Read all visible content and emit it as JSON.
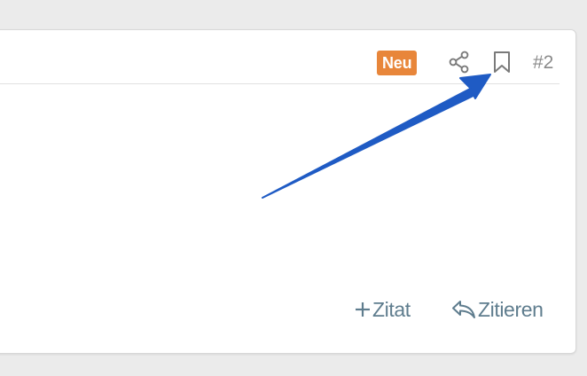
{
  "post": {
    "badge": "Neu",
    "number": "#2",
    "icons": {
      "share": "share-icon",
      "bookmark": "bookmark-icon",
      "add_quote": "plus-icon",
      "reply": "reply-icon"
    },
    "actions": {
      "add_quote_label": "Zitat",
      "quote_label": "Zitieren"
    }
  },
  "colors": {
    "badge_bg": "#e8863a",
    "action_text": "#5f7d8e",
    "icon_gray": "#7a7a7a",
    "arrow": "#1f5bc4"
  }
}
